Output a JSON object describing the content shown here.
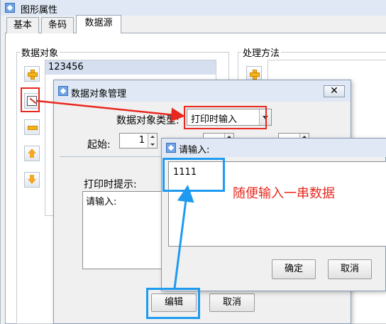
{
  "window": {
    "title": "图形属性"
  },
  "tabs": [
    {
      "label": "基本"
    },
    {
      "label": "条码"
    },
    {
      "label": "数据源",
      "active": true
    }
  ],
  "data_objects": {
    "group_label": "数据对象",
    "items": [
      "123456"
    ],
    "toolbar": [
      "add-icon",
      "edit-icon",
      "remove-icon",
      "move-up-icon",
      "move-down-icon"
    ]
  },
  "processing": {
    "group_label": "处理方法"
  },
  "manage_dialog": {
    "title": "数据对象管理",
    "type_label": "数据对象类型:",
    "type_value": "打印时输入",
    "start_label": "起始:",
    "start_value": "1",
    "prompt_label": "打印时提示:",
    "prompt_value": "请输入:",
    "edit_button": "编辑",
    "cancel_button": "取消"
  },
  "input_dialog": {
    "title": "请输入:",
    "value": "1111",
    "ok_button": "确定",
    "cancel_button": "取消"
  },
  "annotation": {
    "note": "随便输入一串数据",
    "highlight_red": "#e8281f",
    "highlight_blue": "#1e9bf0"
  }
}
